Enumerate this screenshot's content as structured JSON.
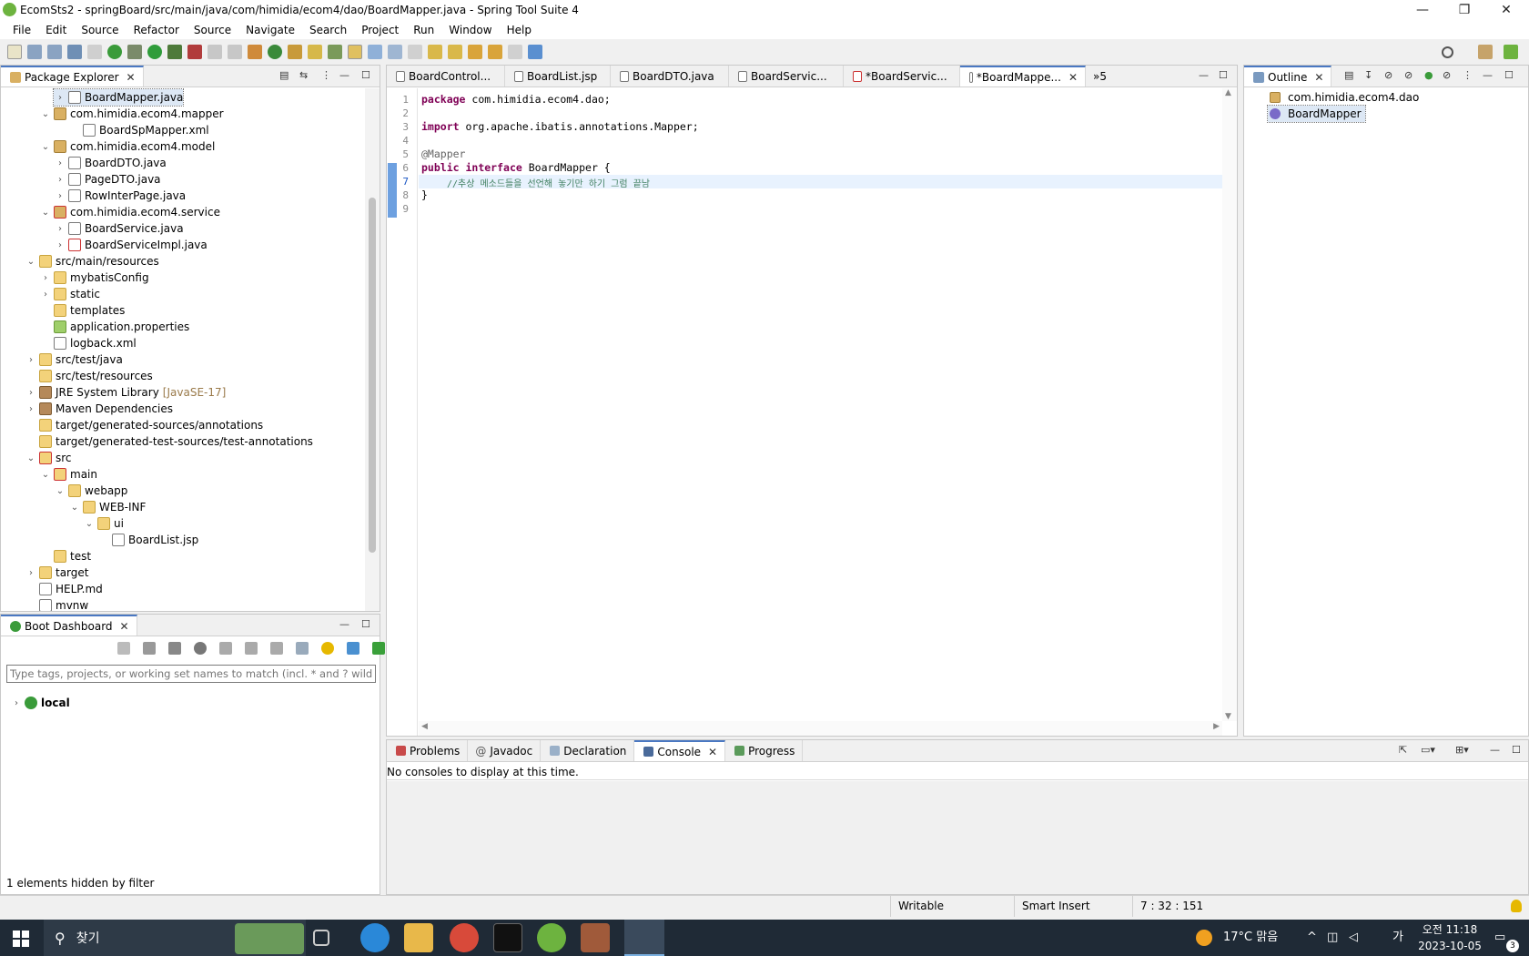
{
  "window": {
    "title": "EcomSts2 - springBoard/src/main/java/com/himidia/ecom4/dao/BoardMapper.java - Spring Tool Suite 4",
    "minimize": "—",
    "restore": "❐",
    "close": "✕"
  },
  "menu": [
    "File",
    "Edit",
    "Source",
    "Refactor",
    "Source",
    "Navigate",
    "Search",
    "Project",
    "Run",
    "Window",
    "Help"
  ],
  "package_explorer": {
    "title": "Package Explorer",
    "close": "✕",
    "items": [
      {
        "label": "BoardMapper.java",
        "arrow": "›",
        "icon": "java-interface-icon"
      },
      {
        "label": "com.himidia.ecom4.mapper",
        "arrow": "⌄",
        "icon": "package-icon"
      },
      {
        "label": "BoardSpMapper.xml",
        "arrow": "",
        "icon": "xml-file-icon"
      },
      {
        "label": "com.himidia.ecom4.model",
        "arrow": "⌄",
        "icon": "package-icon"
      },
      {
        "label": "BoardDTO.java",
        "arrow": "›",
        "icon": "java-file-icon"
      },
      {
        "label": "PageDTO.java",
        "arrow": "›",
        "icon": "java-file-icon"
      },
      {
        "label": "RowInterPage.java",
        "arrow": "›",
        "icon": "java-interface-icon"
      },
      {
        "label": "com.himidia.ecom4.service",
        "arrow": "⌄",
        "icon": "package-error-icon"
      },
      {
        "label": "BoardService.java",
        "arrow": "›",
        "icon": "java-interface-icon"
      },
      {
        "label": "BoardServiceImpl.java",
        "arrow": "›",
        "icon": "java-file-error-icon"
      },
      {
        "label": "src/main/resources",
        "arrow": "⌄",
        "icon": "source-folder-icon"
      },
      {
        "label": "mybatisConfig",
        "arrow": "›",
        "icon": "folder-icon"
      },
      {
        "label": "static",
        "arrow": "›",
        "icon": "folder-icon"
      },
      {
        "label": "templates",
        "arrow": "",
        "icon": "folder-icon"
      },
      {
        "label": "application.properties",
        "arrow": "",
        "icon": "properties-icon"
      },
      {
        "label": "logback.xml",
        "arrow": "",
        "icon": "xml-file-icon"
      },
      {
        "label": "src/test/java",
        "arrow": "›",
        "icon": "source-folder-icon"
      },
      {
        "label": "src/test/resources",
        "arrow": "",
        "icon": "source-folder-icon"
      },
      {
        "label": "JRE System Library",
        "extra": "[JavaSE-17]",
        "arrow": "›",
        "icon": "library-icon"
      },
      {
        "label": "Maven Dependencies",
        "arrow": "›",
        "icon": "library-icon"
      },
      {
        "label": "target/generated-sources/annotations",
        "arrow": "",
        "icon": "source-folder-icon"
      },
      {
        "label": "target/generated-test-sources/test-annotations",
        "arrow": "",
        "icon": "source-folder-icon"
      },
      {
        "label": "src",
        "arrow": "⌄",
        "icon": "folder-error-icon"
      },
      {
        "label": "main",
        "arrow": "⌄",
        "icon": "folder-error-icon"
      },
      {
        "label": "webapp",
        "arrow": "⌄",
        "icon": "folder-icon"
      },
      {
        "label": "WEB-INF",
        "arrow": "⌄",
        "icon": "folder-icon"
      },
      {
        "label": "ui",
        "arrow": "⌄",
        "icon": "folder-icon"
      },
      {
        "label": "BoardList.jsp",
        "arrow": "",
        "icon": "jsp-file-icon"
      },
      {
        "label": "test",
        "arrow": "",
        "icon": "folder-icon"
      },
      {
        "label": "target",
        "arrow": "›",
        "icon": "folder-icon"
      },
      {
        "label": "HELP.md",
        "arrow": "",
        "icon": "markdown-file-icon"
      },
      {
        "label": "mvnw",
        "arrow": "",
        "icon": "file-icon"
      }
    ]
  },
  "boot_dashboard": {
    "title": "Boot Dashboard",
    "close": "✕",
    "filter_placeholder": "Type tags, projects, or working set names to match (incl. * and ? wildcards)",
    "local": "local",
    "hidden_note": "1 elements hidden by filter"
  },
  "editor": {
    "tabs": [
      {
        "label": "BoardControl...",
        "active": false
      },
      {
        "label": "BoardList.jsp",
        "active": false
      },
      {
        "label": "BoardDTO.java",
        "active": false
      },
      {
        "label": "BoardServic...",
        "active": false
      },
      {
        "label": "*BoardServic...",
        "active": false
      },
      {
        "label": "*BoardMappe...",
        "active": true
      }
    ],
    "overflow": "»5",
    "line_numbers": [
      "1",
      "2",
      "3",
      "4",
      "5",
      "6",
      "7",
      "8",
      "9"
    ],
    "code": {
      "l1_kw": "package",
      "l1_rest": " com.himidia.ecom4.dao;",
      "l3_kw": "import",
      "l3_rest": " org.apache.ibatis.annotations.Mapper;",
      "l5": "@Mapper",
      "l6_kw1": "public",
      "l6_kw2": "interface",
      "l6_rest": " BoardMapper {",
      "l7": "//추상 메소드들을 선언해 놓기만 하기 그럼 끝남",
      "l8": "}"
    }
  },
  "outline": {
    "title": "Outline",
    "close": "✕",
    "items": [
      "com.himidia.ecom4.dao",
      "BoardMapper"
    ]
  },
  "console_area": {
    "tabs": [
      "Problems",
      "Javadoc",
      "Declaration",
      "Console",
      "Progress"
    ],
    "active": "Console",
    "message": "No consoles to display at this time."
  },
  "status": {
    "writable": "Writable",
    "insert": "Smart Insert",
    "position": "7 : 32 : 151"
  },
  "taskbar": {
    "search": "찾기",
    "weather": "17°C 맑음",
    "ime": "가",
    "time": "오전 11:18",
    "date": "2023-10-05",
    "notifications": "3"
  },
  "colors": {
    "accent": "#4a78c2",
    "taskbar": "#1f2a36"
  }
}
